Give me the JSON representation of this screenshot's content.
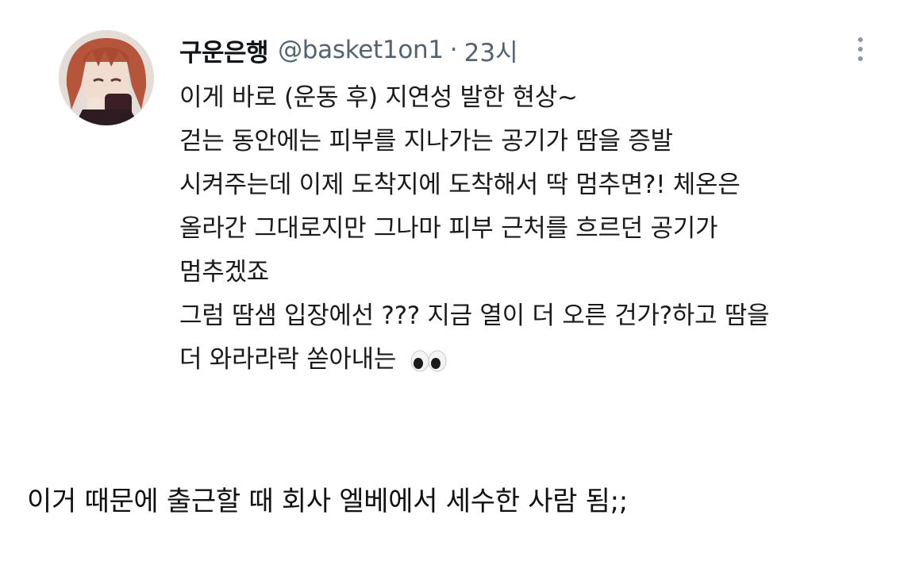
{
  "tweet": {
    "display_name": "구운은행",
    "handle": "@basket1on1",
    "separator": "·",
    "time": "23시",
    "lines": [
      "이게 바로 (운동 후) 지연성 발한 현상~",
      "걷는 동안에는 피부를 지나가는 공기가 땀을 증발",
      "시켜주는데 이제 도착지에 도착해서 딱 멈추면?! 체온은",
      "올라간 그대로지만 그나마 피부 근처를 흐르던 공기가",
      "멈추겠죠",
      "그럼 땀샘 입장에선 ??? 지금 열이 더 오른 건가?하고 땀을",
      "더 와라라락 쏟아내는"
    ],
    "emoji": "eyes-emoji"
  },
  "caption": "이거 때문에 출근할 때 회사 엘베에서 세수한 사람 됨;;",
  "icons": {
    "more": "more-vertical-icon",
    "avatar": "avatar-image"
  },
  "colors": {
    "name": "#0f1419",
    "secondary": "#536471",
    "text": "#1a1a1a",
    "background": "#ffffff"
  }
}
